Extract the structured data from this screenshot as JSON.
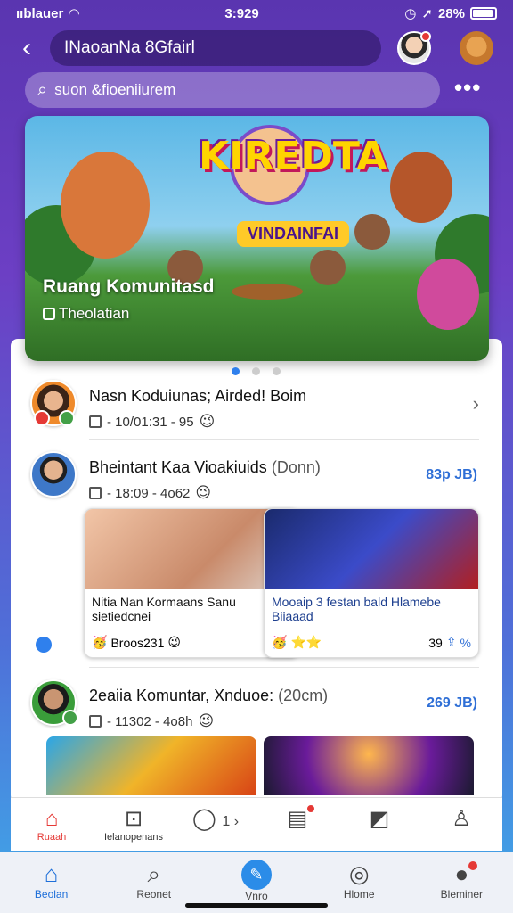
{
  "status_bar": {
    "carrier": "ııblauer",
    "time": "3:929",
    "battery": "28%"
  },
  "topbar": {
    "title": "INaoanNa 8Gfairl"
  },
  "search": {
    "placeholder": "suon &fioeniiurem"
  },
  "hero": {
    "art_title": "KIREDTA",
    "art_subtitle": "VINDAINFAI",
    "title": "Ruang Komunitasd",
    "subtitle": "Theolatian"
  },
  "posts": [
    {
      "name": "Nasn Koduiunas; Airded! Boim",
      "meta": "- 10/01:31 - 95",
      "smiley": "😉"
    },
    {
      "name": "Bheintant Kaa Vioakiuids",
      "duration": "(Donn)",
      "meta": "- 18:09 - 4o62",
      "smiley": "😉",
      "count": "83p JB)",
      "cards": [
        {
          "text": "Nitia Nan Kormaans Sanu sietiedcnei",
          "footer_text": "Broos231",
          "smiley_left": "🥳",
          "smiley_right": "😉"
        },
        {
          "text": "Mooaip 3 festan bald Hlamebe Biiaaad",
          "footer_text": "39",
          "stars": "⭐⭐",
          "smiley_left": "🥳",
          "share_count": "%"
        }
      ]
    },
    {
      "name": "2eaiia Komuntar, Xnduoe:",
      "duration": "(20cm)",
      "meta": "- 11302 - 4o8h",
      "smiley": "😉",
      "count": "269 JB)"
    }
  ],
  "bottom_bar_top": {
    "items": [
      {
        "label": "Ruaah",
        "icon": "home-icon"
      },
      {
        "label": "Ielanopenans",
        "icon": "grid-icon"
      },
      {
        "label": "1 ›",
        "icon": "chat-bubble-icon"
      },
      {
        "label": "",
        "icon": "calendar-icon"
      },
      {
        "label": "",
        "icon": "image-icon"
      },
      {
        "label": "",
        "icon": "person-icon"
      }
    ]
  },
  "bottom_bar": {
    "items": [
      {
        "label": "Beolan",
        "icon": "home-icon"
      },
      {
        "label": "Reonet",
        "icon": "search-icon"
      },
      {
        "label": "Vnro",
        "icon": "create-icon"
      },
      {
        "label": "Hlome",
        "icon": "compass-icon"
      },
      {
        "label": "Bleminer",
        "icon": "profile-icon"
      }
    ]
  },
  "colors": {
    "accent": "#2f6fd6",
    "active_red": "#e53935",
    "background_top": "#5a35b0",
    "background_bottom": "#3fa9e8"
  }
}
